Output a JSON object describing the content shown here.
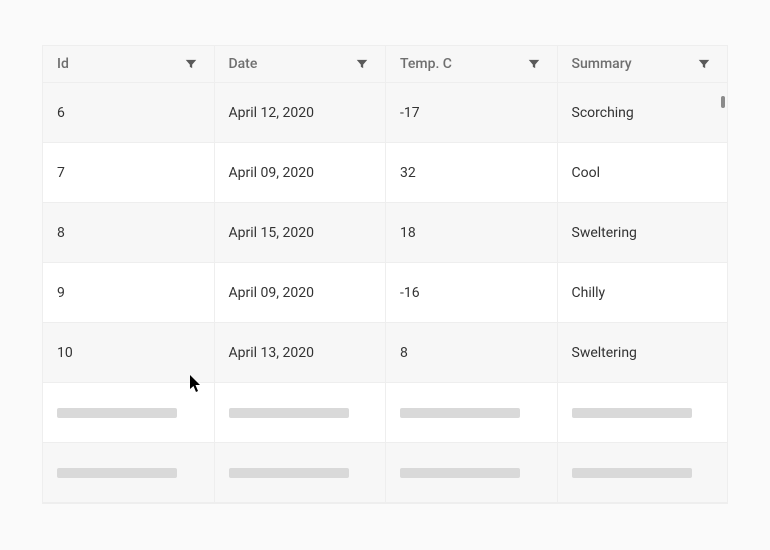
{
  "table": {
    "columns": [
      {
        "key": "id",
        "label": "Id"
      },
      {
        "key": "date",
        "label": "Date"
      },
      {
        "key": "temp",
        "label": "Temp. C"
      },
      {
        "key": "summary",
        "label": "Summary"
      }
    ],
    "rows": [
      {
        "id": "6",
        "date": "April 12, 2020",
        "temp": "-17",
        "summary": "Scorching"
      },
      {
        "id": "7",
        "date": "April 09, 2020",
        "temp": "32",
        "summary": "Cool"
      },
      {
        "id": "8",
        "date": "April 15, 2020",
        "temp": "18",
        "summary": "Sweltering"
      },
      {
        "id": "9",
        "date": "April 09, 2020",
        "temp": "-16",
        "summary": "Chilly"
      },
      {
        "id": "10",
        "date": "April 13, 2020",
        "temp": "8",
        "summary": "Sweltering"
      }
    ],
    "loading_rows": 2
  }
}
